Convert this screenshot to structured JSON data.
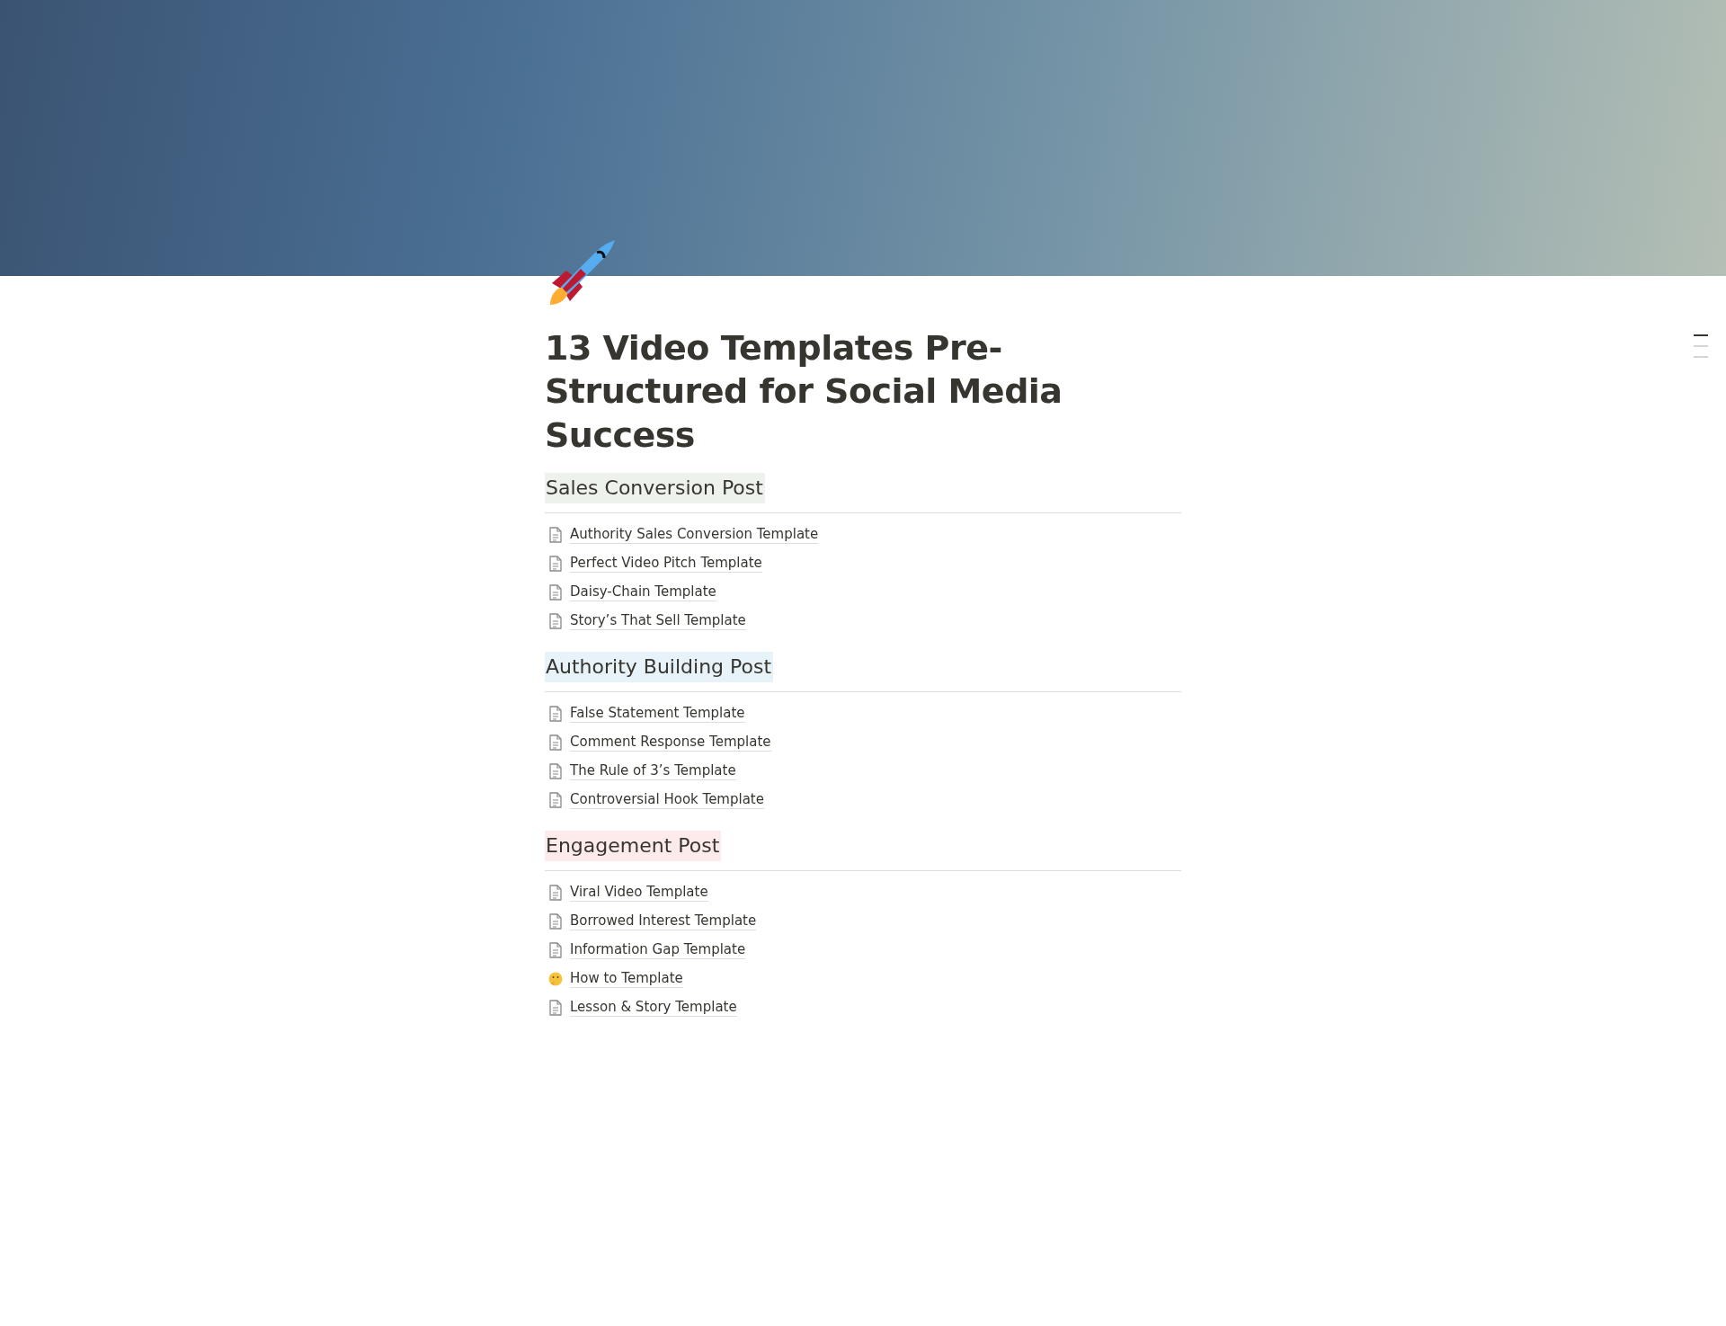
{
  "title": "13 Video Templates Pre-Structured for Social Media Success",
  "sections": [
    {
      "heading": "Sales Conversion Post",
      "color": "#edf3ec",
      "pages": [
        {
          "kind": "page",
          "label": "Authority Sales Conversion Template"
        },
        {
          "kind": "page",
          "label": "Perfect Video Pitch Template"
        },
        {
          "kind": "page",
          "label": "Daisy-Chain Template"
        },
        {
          "kind": "page",
          "label": "Story’s That Sell Template"
        }
      ]
    },
    {
      "heading": "Authority Building Post",
      "color": "#e7f3f8",
      "pages": [
        {
          "kind": "page",
          "label": "False Statement Template"
        },
        {
          "kind": "page",
          "label": "Comment Response Template"
        },
        {
          "kind": "page",
          "label": "The Rule of 3’s Template"
        },
        {
          "kind": "page",
          "label": "Controversial Hook Template"
        }
      ]
    },
    {
      "heading": "Engagement Post",
      "color": "#fdebec",
      "pages": [
        {
          "kind": "page",
          "label": "Viral Video Template"
        },
        {
          "kind": "page",
          "label": "Borrowed Interest Template"
        },
        {
          "kind": "page",
          "label": "Information Gap Template"
        },
        {
          "kind": "emoji",
          "label": "How to Template"
        },
        {
          "kind": "page",
          "label": "Lesson & Story Template"
        }
      ]
    }
  ],
  "outline": [
    {
      "selected": true
    },
    {
      "selected": false
    },
    {
      "selected": false
    }
  ]
}
